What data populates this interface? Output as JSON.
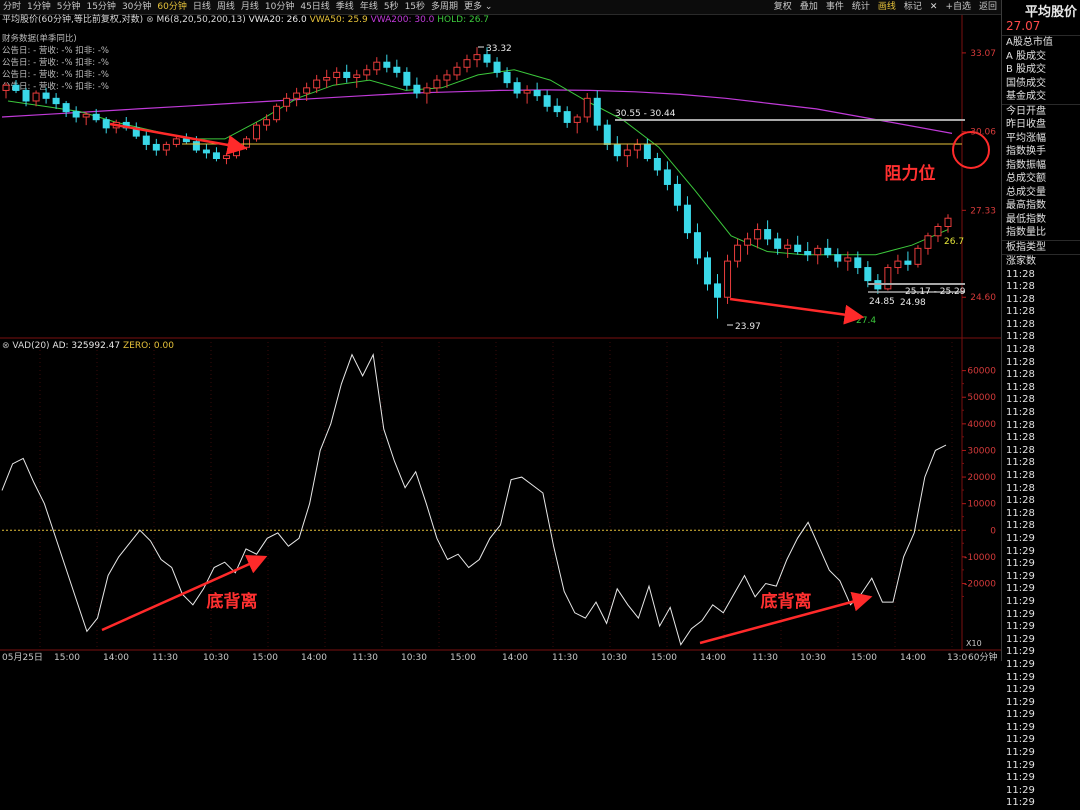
{
  "toolbar": {
    "periods": [
      "分时",
      "1分钟",
      "5分钟",
      "15分钟",
      "30分钟",
      "60分钟",
      "日线",
      "周线",
      "月线",
      "10分钟",
      "45日线",
      "季线",
      "年线",
      "5秒",
      "15秒",
      "多周期",
      "更多"
    ],
    "active_period": "60分钟",
    "actions": [
      "复权",
      "叠加",
      "事件",
      "统计",
      "画线",
      "标记",
      "+自选",
      "返回"
    ],
    "active_action": "画线",
    "close_icon": "close-icon"
  },
  "main": {
    "legend": {
      "name": "平均股价(60分钟,等比前复权,对数)",
      "indicator": "M6(8,20,50,200,13)",
      "vwa20": "VWA20: 26.0",
      "vwa50": "VWA50: 25.9",
      "vwa200": "VWA200: 30.0",
      "hold": "HOLD: 26.7"
    },
    "finance": {
      "title": "财务数据(单季同比)",
      "rows": [
        "公告日: -   营收: -%   扣非: -%",
        "公告日: -   营收: -%   扣非: -%",
        "公告日: -   营收: -%   扣非: -%",
        "公告日: -   营收: -%   扣非: -%"
      ]
    },
    "annotation_resistance": "阻力位"
  },
  "sub": {
    "legend": {
      "name": "VAD(20)",
      "ad": "AD: 325992.47",
      "zero": "ZERO: 0.00"
    },
    "divergence_label_left": "底背离",
    "divergence_label_right": "底背离"
  },
  "side": {
    "title": "平均股价",
    "price": "27.07",
    "items": [
      "A股总市值",
      "A 股成交",
      "B 股成交",
      "国债成交",
      "基金成交",
      "今日开盘",
      "昨日收盘",
      "平均涨幅",
      "指数换手",
      "指数振幅",
      "总成交额",
      "总成交量",
      "最高指数",
      "最低指数",
      "指数量比",
      "板指类型",
      "涨家数"
    ],
    "time_ticks": [
      "11:28",
      "11:28",
      "11:28",
      "11:28",
      "11:28",
      "11:28",
      "11:28",
      "11:28",
      "11:28",
      "11:28",
      "11:28",
      "11:28",
      "11:28",
      "11:28",
      "11:28",
      "11:28",
      "11:28",
      "11:28",
      "11:28",
      "11:28",
      "11:28",
      "11:29",
      "11:29",
      "11:29",
      "11:29",
      "11:29",
      "11:29",
      "11:29",
      "11:29",
      "11:29",
      "11:29",
      "11:29",
      "11:29",
      "11:29",
      "11:29",
      "11:29",
      "11:29",
      "11:29",
      "11:29",
      "11:29",
      "11:29",
      "11:29",
      "11:29"
    ]
  },
  "chart_data": [
    {
      "type": "candlestick",
      "log_scale": true,
      "y_ticks": [
        33.07,
        30.06,
        27.33,
        24.6
      ],
      "ylim": [
        23.5,
        34.0
      ],
      "x_ticks": [
        "05月25日",
        "15:00",
        "14:00",
        "11:30",
        "10:30",
        "15:00",
        "14:00",
        "11:30",
        "10:30",
        "15:00",
        "14:00",
        "11:30",
        "10:30",
        "15:00",
        "14:00",
        "11:30",
        "10:30",
        "15:00",
        "14:00",
        "13:0",
        "60分钟"
      ],
      "candles": [
        [
          31.6,
          31.9,
          31.3,
          31.8
        ],
        [
          31.8,
          32.0,
          31.5,
          31.6
        ],
        [
          31.6,
          31.7,
          31.0,
          31.2
        ],
        [
          31.2,
          31.6,
          31.0,
          31.5
        ],
        [
          31.5,
          31.7,
          31.1,
          31.3
        ],
        [
          31.3,
          31.5,
          30.9,
          31.1
        ],
        [
          31.1,
          31.2,
          30.6,
          30.8
        ],
        [
          30.8,
          31.0,
          30.4,
          30.6
        ],
        [
          30.6,
          30.8,
          30.3,
          30.7
        ],
        [
          30.7,
          30.9,
          30.4,
          30.5
        ],
        [
          30.5,
          30.6,
          30.0,
          30.2
        ],
        [
          30.2,
          30.5,
          30.0,
          30.4
        ],
        [
          30.4,
          30.6,
          30.1,
          30.2
        ],
        [
          30.2,
          30.4,
          29.8,
          29.9
        ],
        [
          29.9,
          30.1,
          29.4,
          29.6
        ],
        [
          29.6,
          29.8,
          29.2,
          29.4
        ],
        [
          29.4,
          29.7,
          29.2,
          29.6
        ],
        [
          29.6,
          29.9,
          29.5,
          29.8
        ],
        [
          29.8,
          30.0,
          29.6,
          29.7
        ],
        [
          29.7,
          29.9,
          29.3,
          29.4
        ],
        [
          29.4,
          29.6,
          29.1,
          29.3
        ],
        [
          29.3,
          29.5,
          29.0,
          29.1
        ],
        [
          29.1,
          29.3,
          28.9,
          29.2
        ],
        [
          29.2,
          29.6,
          29.1,
          29.5
        ],
        [
          29.5,
          29.9,
          29.4,
          29.8
        ],
        [
          29.8,
          30.4,
          29.7,
          30.3
        ],
        [
          30.3,
          30.7,
          30.1,
          30.5
        ],
        [
          30.5,
          31.1,
          30.4,
          31.0
        ],
        [
          31.0,
          31.5,
          30.8,
          31.3
        ],
        [
          31.3,
          31.7,
          31.0,
          31.5
        ],
        [
          31.5,
          31.9,
          31.2,
          31.7
        ],
        [
          31.7,
          32.2,
          31.5,
          32.0
        ],
        [
          32.0,
          32.4,
          31.7,
          32.1
        ],
        [
          32.1,
          32.5,
          31.8,
          32.3
        ],
        [
          32.3,
          32.6,
          31.9,
          32.1
        ],
        [
          32.1,
          32.4,
          31.7,
          32.2
        ],
        [
          32.2,
          32.6,
          32.0,
          32.4
        ],
        [
          32.4,
          32.9,
          32.2,
          32.7
        ],
        [
          32.7,
          33.0,
          32.3,
          32.5
        ],
        [
          32.5,
          32.8,
          32.1,
          32.3
        ],
        [
          32.3,
          32.5,
          31.6,
          31.8
        ],
        [
          31.8,
          32.1,
          31.3,
          31.5
        ],
        [
          31.5,
          31.9,
          31.1,
          31.7
        ],
        [
          31.7,
          32.2,
          31.5,
          32.0
        ],
        [
          32.0,
          32.4,
          31.7,
          32.2
        ],
        [
          32.2,
          32.7,
          32.0,
          32.5
        ],
        [
          32.5,
          33.0,
          32.3,
          32.8
        ],
        [
          32.8,
          33.3,
          32.5,
          33.0
        ],
        [
          33.0,
          33.3,
          32.5,
          32.7
        ],
        [
          32.7,
          32.9,
          32.1,
          32.3
        ],
        [
          32.3,
          32.5,
          31.7,
          31.9
        ],
        [
          31.9,
          32.1,
          31.3,
          31.5
        ],
        [
          31.5,
          31.8,
          31.1,
          31.6
        ],
        [
          31.6,
          31.9,
          31.2,
          31.4
        ],
        [
          31.4,
          31.6,
          30.8,
          31.0
        ],
        [
          31.0,
          31.3,
          30.6,
          30.8
        ],
        [
          30.8,
          31.0,
          30.2,
          30.4
        ],
        [
          30.4,
          30.7,
          30.0,
          30.6
        ],
        [
          30.6,
          31.5,
          30.4,
          31.3
        ],
        [
          31.3,
          31.6,
          30.1,
          30.3
        ],
        [
          30.3,
          30.5,
          29.4,
          29.6
        ],
        [
          29.6,
          29.9,
          29.0,
          29.2
        ],
        [
          29.2,
          29.6,
          28.8,
          29.4
        ],
        [
          29.4,
          29.8,
          29.1,
          29.6
        ],
        [
          29.6,
          29.8,
          29.0,
          29.1
        ],
        [
          29.1,
          29.3,
          28.5,
          28.7
        ],
        [
          28.7,
          29.0,
          28.0,
          28.2
        ],
        [
          28.2,
          28.5,
          27.3,
          27.5
        ],
        [
          27.5,
          27.8,
          26.4,
          26.6
        ],
        [
          26.6,
          26.9,
          25.6,
          25.8
        ],
        [
          25.8,
          26.0,
          24.8,
          25.0
        ],
        [
          25.0,
          25.3,
          23.97,
          24.6
        ],
        [
          24.6,
          25.9,
          24.4,
          25.7
        ],
        [
          25.7,
          26.4,
          25.5,
          26.2
        ],
        [
          26.2,
          26.6,
          25.9,
          26.4
        ],
        [
          26.4,
          26.9,
          26.1,
          26.7
        ],
        [
          26.7,
          27.0,
          26.2,
          26.4
        ],
        [
          26.4,
          26.6,
          25.9,
          26.1
        ],
        [
          26.1,
          26.4,
          25.8,
          26.2
        ],
        [
          26.2,
          26.5,
          25.9,
          26.0
        ],
        [
          26.0,
          26.3,
          25.7,
          25.9
        ],
        [
          25.9,
          26.2,
          25.6,
          26.1
        ],
        [
          26.1,
          26.4,
          25.8,
          25.9
        ],
        [
          25.9,
          26.1,
          25.5,
          25.7
        ],
        [
          25.7,
          26.0,
          25.4,
          25.8
        ],
        [
          25.8,
          26.0,
          25.3,
          25.5
        ],
        [
          25.5,
          25.7,
          24.9,
          25.1
        ],
        [
          25.1,
          25.3,
          24.7,
          24.85
        ],
        [
          24.85,
          25.6,
          24.8,
          25.5
        ],
        [
          25.5,
          25.9,
          25.3,
          25.7
        ],
        [
          25.7,
          26.0,
          25.4,
          25.6
        ],
        [
          25.6,
          26.2,
          25.5,
          26.1
        ],
        [
          26.1,
          26.6,
          25.9,
          26.5
        ],
        [
          26.5,
          26.9,
          26.3,
          26.8
        ],
        [
          26.8,
          27.2,
          26.6,
          27.07
        ]
      ],
      "lines": {
        "vwa200": [
          30.6,
          30.7,
          30.8,
          30.9,
          31.0,
          31.1,
          31.2,
          31.3,
          31.4,
          31.5,
          31.55,
          31.6,
          31.62,
          31.6,
          31.55,
          31.45,
          31.3,
          31.1,
          30.9,
          30.6,
          30.3,
          30.0
        ],
        "hold": [
          31.2,
          31.0,
          30.8,
          30.4,
          30.1,
          29.8,
          29.8,
          30.5,
          31.3,
          31.8,
          32.0,
          31.6,
          31.7,
          32.2,
          32.4,
          32.0,
          31.2,
          30.5,
          29.5,
          28.0,
          26.5,
          26.0,
          25.9,
          25.9,
          25.9,
          26.2,
          26.7
        ]
      },
      "price_labels": {
        "high": "33.32",
        "low": "23.97",
        "bottom_low": "24.85",
        "range1": "30.55 - 30.44",
        "range2": "25.17 - 25.29",
        "range2b": "24.98",
        "hold_label": "26.7",
        "target": "27.4"
      }
    },
    {
      "type": "line",
      "name": "VAD(20)",
      "y_ticks": [
        60000,
        50000,
        40000,
        30000,
        20000,
        10000,
        0,
        -10000,
        -20000
      ],
      "ylim": [
        -45000,
        67000
      ],
      "values": [
        15000,
        25000,
        27000,
        18000,
        10000,
        -2000,
        -14000,
        -26000,
        -38000,
        -33000,
        -17000,
        -10000,
        -5000,
        0,
        -4000,
        -11000,
        -14000,
        -24000,
        -28000,
        -22000,
        -14000,
        -12000,
        -16000,
        -7000,
        -9000,
        -3000,
        -1000,
        -6000,
        -3000,
        10000,
        30000,
        40000,
        55000,
        66000,
        58000,
        66000,
        38000,
        26000,
        16000,
        22000,
        10000,
        -3000,
        -11000,
        -9000,
        -14000,
        -11000,
        -3000,
        2000,
        19000,
        20000,
        17000,
        14000,
        -6000,
        -23000,
        -31000,
        -33000,
        -27000,
        -35000,
        -22000,
        -28000,
        -33000,
        -21000,
        -36000,
        -29000,
        -43000,
        -37000,
        -34000,
        -28000,
        -31000,
        -24000,
        -17000,
        -25000,
        -20000,
        -21000,
        -11000,
        -3000,
        3000,
        -6000,
        -15000,
        -19000,
        -28000,
        -24000,
        -18000,
        -27000,
        -27000,
        -10000,
        -1000,
        20000,
        30000,
        32000
      ]
    }
  ]
}
